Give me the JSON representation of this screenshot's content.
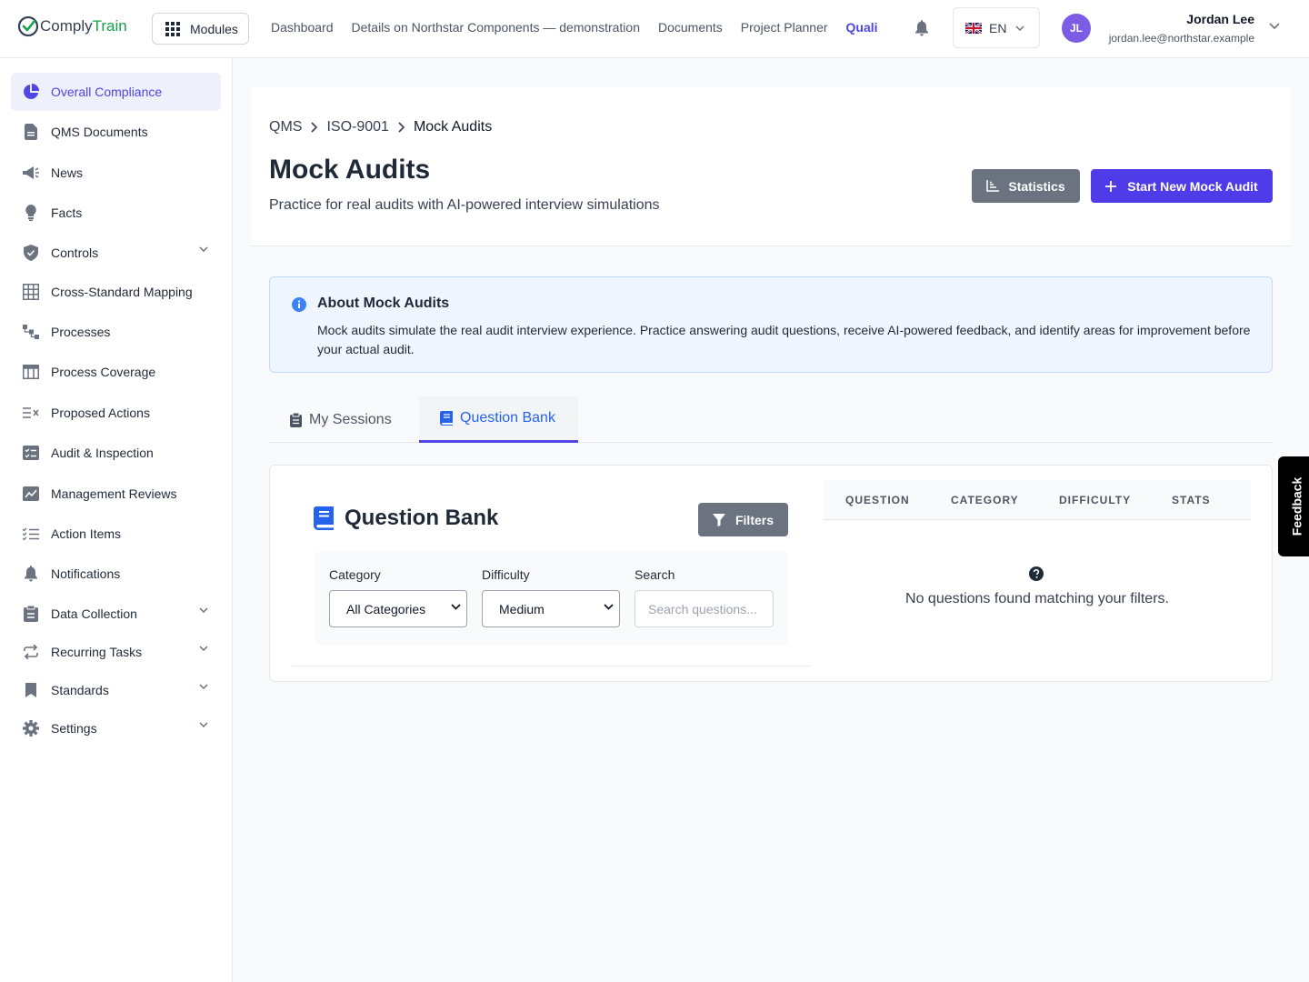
{
  "topbar": {
    "logo_part1": "Comply",
    "logo_part2": "Train",
    "modules_label": "Modules",
    "nav": [
      "Dashboard",
      "Details on Northstar Components — demonstration",
      "Documents",
      "Project Planner"
    ],
    "nav_active": "Quali",
    "language": "EN",
    "user": {
      "initials": "JL",
      "name": "Jordan Lee",
      "email": "jordan.lee@northstar.example"
    }
  },
  "sidebar": {
    "items": [
      {
        "label": "Overall Compliance",
        "icon": "pie-chart-icon",
        "active": true
      },
      {
        "label": "QMS Documents",
        "icon": "document-icon"
      },
      {
        "label": "News",
        "icon": "megaphone-icon"
      },
      {
        "label": "Facts",
        "icon": "lightbulb-icon"
      },
      {
        "label": "Controls",
        "icon": "shield-icon",
        "expandable": true
      },
      {
        "label": "Cross-Standard Mapping",
        "icon": "grid-icon"
      },
      {
        "label": "Processes",
        "icon": "process-icon"
      },
      {
        "label": "Process Coverage",
        "icon": "table-icon"
      },
      {
        "label": "Proposed Actions",
        "icon": "list-x-icon"
      },
      {
        "label": "Audit & Inspection",
        "icon": "checklist-icon"
      },
      {
        "label": "Management Reviews",
        "icon": "chart-review-icon"
      },
      {
        "label": "Action Items",
        "icon": "list-check-icon"
      },
      {
        "label": "Notifications",
        "icon": "bell-icon"
      },
      {
        "label": "Data Collection",
        "icon": "clipboard-icon",
        "expandable": true
      },
      {
        "label": "Recurring Tasks",
        "icon": "repeat-icon",
        "expandable": true
      },
      {
        "label": "Standards",
        "icon": "bookmark-icon",
        "expandable": true
      },
      {
        "label": "Settings",
        "icon": "gear-icon",
        "expandable": true
      }
    ]
  },
  "header": {
    "breadcrumb": [
      "QMS",
      "ISO-9001",
      "Mock Audits"
    ],
    "title": "Mock Audits",
    "subtitle": "Practice for real audits with AI-powered interview simulations",
    "statistics_label": "Statistics",
    "start_label": "Start New Mock Audit"
  },
  "info": {
    "title": "About Mock Audits",
    "text": "Mock audits simulate the real audit interview experience. Practice answering audit questions, receive AI-powered feedback, and identify areas for improvement before your actual audit."
  },
  "tabs": [
    {
      "label": "My Sessions",
      "active": false
    },
    {
      "label": "Question Bank",
      "active": true
    }
  ],
  "question_bank": {
    "title": "Question Bank",
    "filters_label": "Filters",
    "category_label": "Category",
    "category_value": "All Categories",
    "difficulty_label": "Difficulty",
    "difficulty_value": "Medium",
    "search_label": "Search",
    "search_placeholder": "Search questions...",
    "columns": [
      "QUESTION",
      "CATEGORY",
      "DIFFICULTY",
      "STATS"
    ],
    "empty_message": "No questions found matching your filters."
  },
  "feedback_label": "Feedback",
  "colors": {
    "accent": "#4f46e5",
    "primary_button": "#4f3ce8",
    "secondary_button": "#6b7280",
    "logo_green": "#16a34a",
    "info_bg": "#eff6ff"
  }
}
